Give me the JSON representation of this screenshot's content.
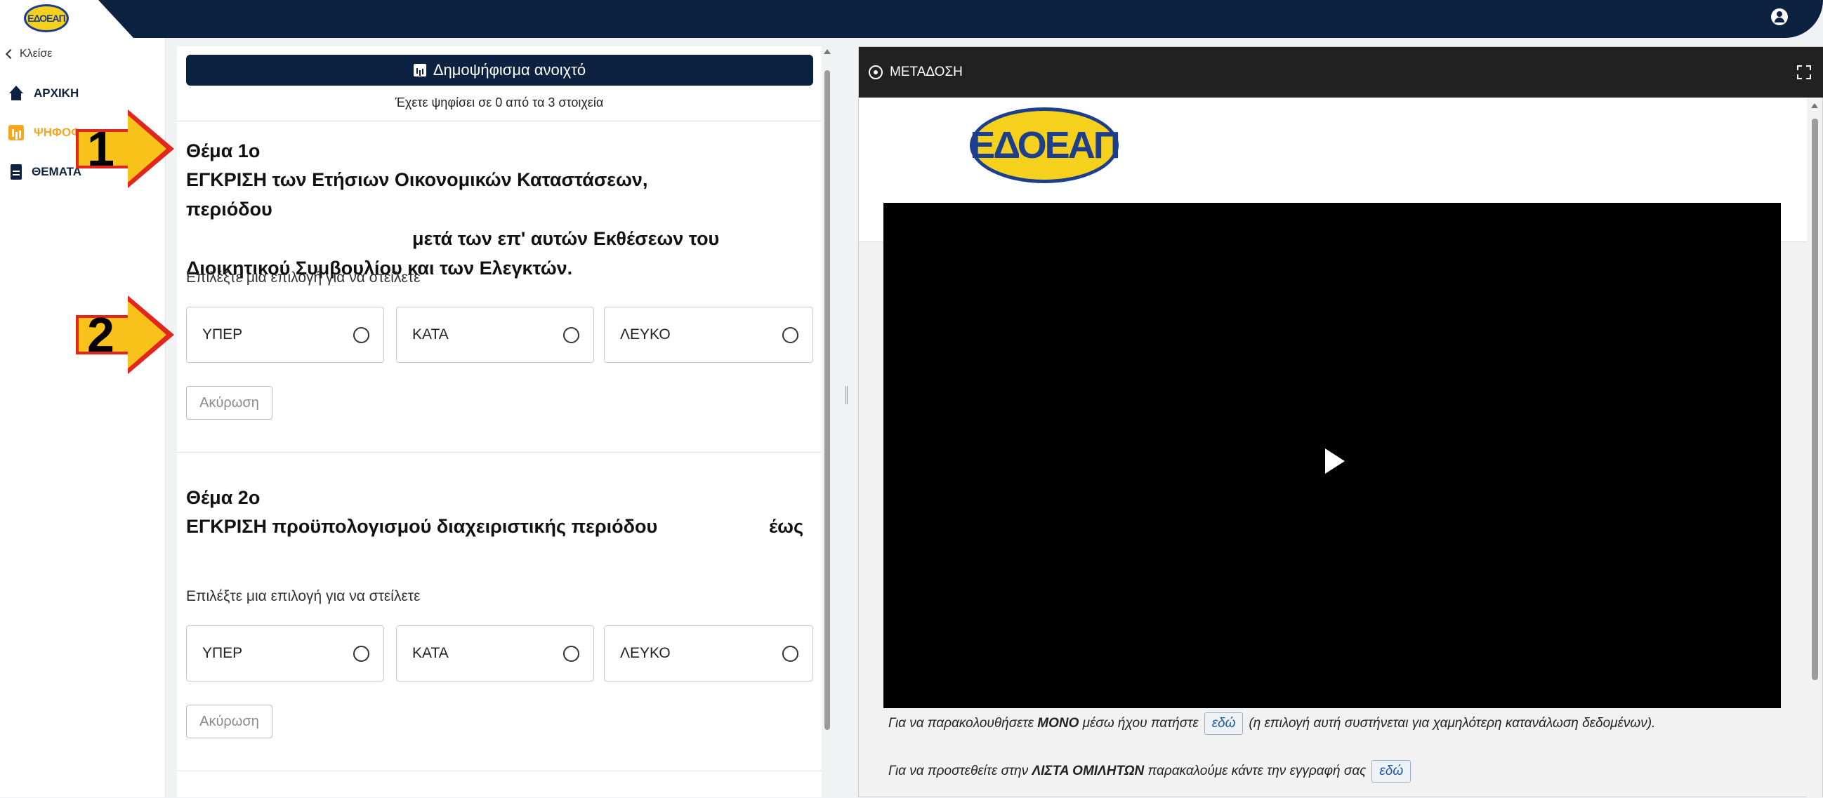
{
  "app": {
    "logo_text": "ΕΔΟΕΑΠ"
  },
  "sidebar": {
    "back_label": "Κλείσε",
    "items": [
      {
        "label": "ΑΡΧΙΚΗ"
      },
      {
        "label": "ΨΗΦΟΦ"
      },
      {
        "label": "ΘΕΜΑΤΑ"
      }
    ]
  },
  "vote": {
    "header": "Δημοψήφισμα ανοιχτό",
    "progress": "Έχετε ψηφίσει σε 0 από τα 3 στοιχεία",
    "topics": [
      {
        "number": "Θέμα 1ο",
        "title_line1": "ΕΓΚΡΙΣΗ των Ετήσιων Οικονομικών Καταστάσεων, περιόδου",
        "title_line2": "μετά των επ' αυτών Εκθέσεων του",
        "title_line3": "Διοικητικού Συμβουλίου και των Ελεγκτών.",
        "instruction": "Επιλέξτε μια επιλογή για να στείλετε",
        "options": [
          "ΥΠΕΡ",
          "ΚΑΤΑ",
          "ΛΕΥΚΟ"
        ],
        "cancel": "Ακύρωση"
      },
      {
        "number": "Θέμα 2ο",
        "title_line1": "ΕΓΚΡΙΣΗ προϋπολογισμού διαχειριστικής περιόδου",
        "title_end": "έως",
        "instruction": "Επιλέξτε μια επιλογή για να στείλετε",
        "options": [
          "ΥΠΕΡ",
          "ΚΑΤΑ",
          "ΛΕΥΚΟ"
        ],
        "cancel": "Ακύρωση"
      }
    ]
  },
  "annotations": {
    "arrow1": "1",
    "arrow2": "2"
  },
  "stream": {
    "title": "ΜΕΤΑΔΟΣΗ",
    "logo_text": "ΕΔΟΕΑΠ",
    "audio_prefix": "Για να παρακολουθήσετε",
    "audio_bold": "ΜΟΝΟ",
    "audio_mid": "μέσω ήχου πατήστε",
    "here": "εδώ",
    "audio_suffix": "(η επιλογή αυτή συστήνεται για χαμηλότερη κατανάλωση δεδομένων).",
    "speakers_prefix": "Για να προστεθείτε στην",
    "speakers_bold": "ΛΙΣΤΑ ΟΜΙΛΗΤΩΝ",
    "speakers_suffix": "παρακαλούμε κάντε την εγγραφή σας"
  },
  "colors": {
    "navy": "#0c2240",
    "accent": "#f5a623",
    "arrow_fill": "#f9c21b",
    "arrow_border": "#e3261c"
  }
}
